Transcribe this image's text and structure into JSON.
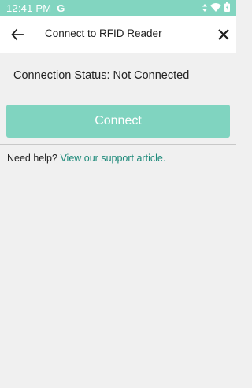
{
  "status_bar": {
    "time": "12:41 PM",
    "g_glyph": "G",
    "icons": [
      "data-arrows-icon",
      "wifi-icon",
      "battery-icon"
    ]
  },
  "app_bar": {
    "title": "Connect to RFID Reader",
    "back_icon": "arrow-left-icon",
    "close_icon": "close-icon"
  },
  "connection": {
    "status_label": "Connection Status: Not Connected"
  },
  "connect_button": {
    "label": "Connect"
  },
  "help": {
    "prefix": "Need help?",
    "link_text": "View our support article."
  },
  "colors": {
    "accent": "#82d5c0",
    "link": "#1e8a7a",
    "background": "#f0f0f0"
  }
}
